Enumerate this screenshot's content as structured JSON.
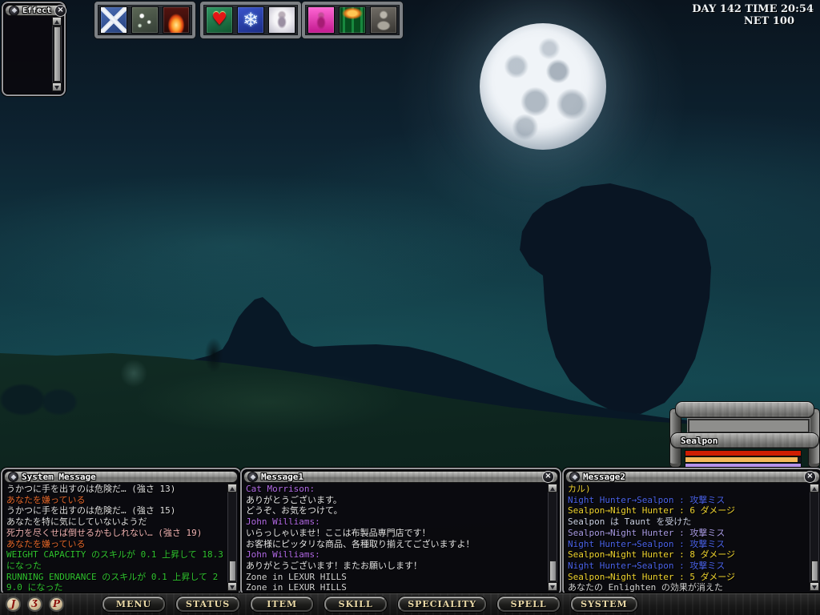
{
  "ui": {
    "close_glyph": "×"
  },
  "hud": {
    "day_time": "DAY 142 TIME 20:54",
    "net": "NET 100"
  },
  "effect_window": {
    "title": "Effect"
  },
  "hotbar": {
    "groups": [
      {
        "icons": [
          {
            "name": "crossed-swords-icon"
          },
          {
            "name": "sparkle-icon"
          },
          {
            "name": "flame-icon"
          }
        ]
      },
      {
        "icons": [
          {
            "name": "heart-icon",
            "glyph": "♥"
          },
          {
            "name": "snowflake-icon",
            "glyph": "❄"
          },
          {
            "name": "spirit-icon"
          }
        ]
      },
      {
        "icons": [
          {
            "name": "pink-figure-icon"
          },
          {
            "name": "nature-flame-icon"
          },
          {
            "name": "statue-icon"
          }
        ]
      }
    ]
  },
  "target_frame": {
    "name": "Sealpon",
    "bars": [
      {
        "name": "hp-bar",
        "bg": "#cf1d02",
        "fill": 100
      },
      {
        "name": "mp-bar",
        "bg": "#f5b95a",
        "fill": 97
      },
      {
        "name": "st-bar",
        "bg": "#b592ec",
        "fill": 100
      }
    ]
  },
  "chat_windows": [
    {
      "title": "System Message",
      "lines": [
        {
          "text": "うかつに手を出すのは危険だ… (強さ 13)",
          "color": "#dedede"
        },
        {
          "text": "あなたを嫌っている",
          "color": "#e2662a"
        },
        {
          "text": "うかつに手を出すのは危険だ… (強さ 15)",
          "color": "#dedede"
        },
        {
          "text": "あなたを特に気にしていないようだ",
          "color": "#dedede"
        },
        {
          "text": "死力を尽くせば倒せるかもしれない… (強さ 19)",
          "color": "#f0b2b2"
        },
        {
          "text": "あなたを嫌っている",
          "color": "#e2662a"
        },
        {
          "text": "WEIGHT CAPACITY のスキルが 0.1 上昇して 18.3 になった",
          "color": "#30c330"
        },
        {
          "text": "RUNNING ENDURANCE のスキルが 0.1 上昇して 29.0 になった",
          "color": "#30c330"
        }
      ]
    },
    {
      "title": "Message1",
      "lines": [
        {
          "text": "Cat Morrison:",
          "color": "#b26ae6"
        },
        {
          "text": "ありがとうございます。",
          "color": "#e4e4e4"
        },
        {
          "text": "どうぞ、お気をつけて。",
          "color": "#e4e4e4"
        },
        {
          "text": "John Williams:",
          "color": "#b26ae6"
        },
        {
          "text": "いらっしゃいませ！ここは布製品専門店です！",
          "color": "#e4e4e4"
        },
        {
          "text": "お客様にピッタリな商品、各種取り揃えてございますよ！",
          "color": "#e4e4e4"
        },
        {
          "text": "John Williams:",
          "color": "#b26ae6"
        },
        {
          "text": "ありがとうございます！またお願いします！",
          "color": "#e4e4e4"
        },
        {
          "text": "Zone in LEXUR HILLS",
          "color": "#d2d2d2"
        },
        {
          "text": "Zone in LEXUR HILLS",
          "color": "#d2d2d2"
        }
      ]
    },
    {
      "title": "Message2",
      "lines": [
        {
          "text": "カル)",
          "color": "#e8cc30"
        },
        {
          "text": "Night Hunter→Sealpon : 攻撃ミス",
          "color": "#4a62e8"
        },
        {
          "text": "Sealpon→Night Hunter : 6 ダメージ",
          "color": "#eed32e"
        },
        {
          "text": "Sealpon は Taunt を受けた",
          "color": "#ccd2e4"
        },
        {
          "text": "Sealpon→Night Hunter : 攻撃ミス",
          "color": "#a89ae2"
        },
        {
          "text": "Night Hunter→Sealpon : 攻撃ミス",
          "color": "#4a62e8"
        },
        {
          "text": "Sealpon→Night Hunter : 8 ダメージ",
          "color": "#eed32e"
        },
        {
          "text": "Night Hunter→Sealpon : 攻撃ミス",
          "color": "#4a62e8"
        },
        {
          "text": "Sealpon→Night Hunter : 5 ダメージ",
          "color": "#eed32e"
        },
        {
          "text": "あなたの Enlighten の効果が消えた",
          "color": "#d2d2d2"
        }
      ]
    }
  ],
  "menu_bar": {
    "coins": [
      {
        "name": "coin-j-button",
        "glyph": "J"
      },
      {
        "name": "coin-ts-button",
        "glyph": "Ʒ"
      },
      {
        "name": "coin-p-button",
        "glyph": "P"
      }
    ],
    "buttons": [
      {
        "label": "MENU"
      },
      {
        "label": "STATUS"
      },
      {
        "label": "ITEM"
      },
      {
        "label": "SKILL"
      },
      {
        "label": "SPECIALITY"
      },
      {
        "label": "SPELL"
      },
      {
        "label": "SYSTEM"
      }
    ]
  }
}
